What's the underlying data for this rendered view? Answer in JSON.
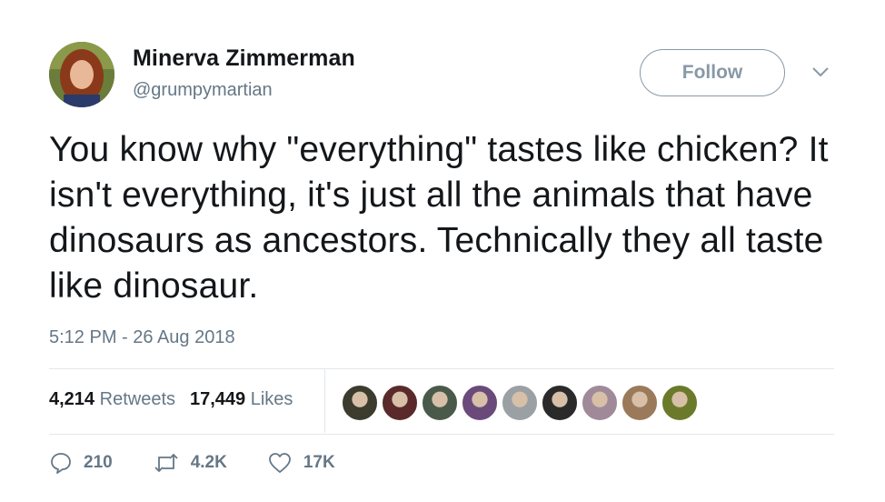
{
  "author": {
    "name": "Minerva Zimmerman",
    "handle": "@grumpymartian"
  },
  "follow_label": "Follow",
  "tweet": {
    "text": "You know why \"everything\" tastes like chicken? It isn't everything, it's just all the animals that have dinosaurs as ancestors. Technically they all taste like dinosaur.",
    "timestamp": "5:12 PM - 26 Aug 2018"
  },
  "stats": {
    "retweets_count": "4,214",
    "retweets_label": "Retweets",
    "likes_count": "17,449",
    "likes_label": "Likes"
  },
  "liker_colors": [
    "#3b3b2e",
    "#5a2a2a",
    "#4a5a4a",
    "#6a4a7a",
    "#9aa0a4",
    "#2a2a2a",
    "#a08a9a",
    "#9a7a5a",
    "#6a7a2a"
  ],
  "actions": {
    "replies": "210",
    "retweets": "4.2K",
    "likes": "17K"
  },
  "colors": {
    "text": "#14171a",
    "secondary": "#657786",
    "border": "#e1e8ed"
  }
}
